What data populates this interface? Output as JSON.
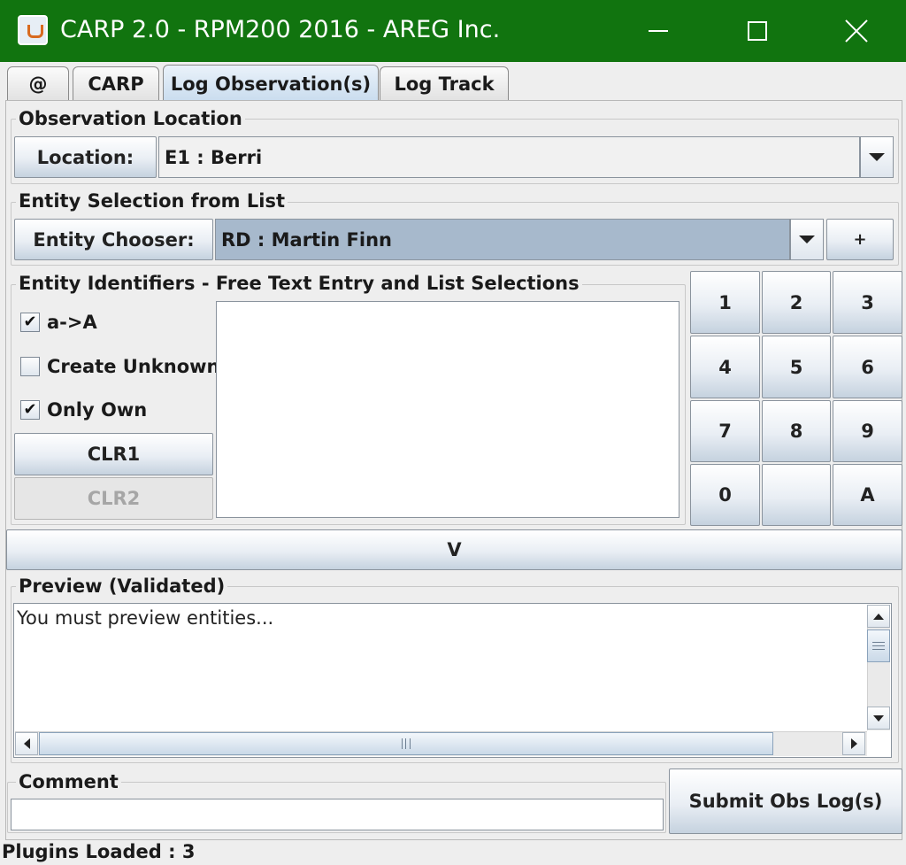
{
  "window": {
    "title": "CARP 2.0 - RPM200 2016 - AREG Inc."
  },
  "tabs": [
    {
      "label": "@"
    },
    {
      "label": "CARP"
    },
    {
      "label": "Log Observation(s)",
      "active": true
    },
    {
      "label": "Log Track"
    }
  ],
  "observation_location": {
    "legend": "Observation Location",
    "button_label": "Location:",
    "selected": "E1 : Berri"
  },
  "entity_selection": {
    "legend": "Entity Selection from List",
    "button_label": "Entity Chooser:",
    "selected": "RD : Martin Finn",
    "add_label": "+"
  },
  "entity_identifiers": {
    "legend": "Entity Identifiers - Free Text Entry and List Selections",
    "options": [
      {
        "label": "a->A",
        "checked": true,
        "mark": "✔"
      },
      {
        "label": "Create Unknown",
        "checked": false,
        "mark": ""
      },
      {
        "label": "Only Own",
        "checked": true,
        "mark": "✔"
      }
    ],
    "clr1_label": "CLR1",
    "clr2_label": "CLR2"
  },
  "keypad": [
    "1",
    "2",
    "3",
    "4",
    "5",
    "6",
    "7",
    "8",
    "9",
    "0",
    "",
    "A"
  ],
  "validate_label": "V",
  "preview": {
    "legend": "Preview (Validated)",
    "text": "You must preview entities..."
  },
  "comment": {
    "legend": "Comment",
    "value": ""
  },
  "submit_label": "Submit Obs Log(s)",
  "status": "Plugins Loaded : 3",
  "colors": {
    "titlebar": "#11740f",
    "selection": "#a7b9cc"
  }
}
